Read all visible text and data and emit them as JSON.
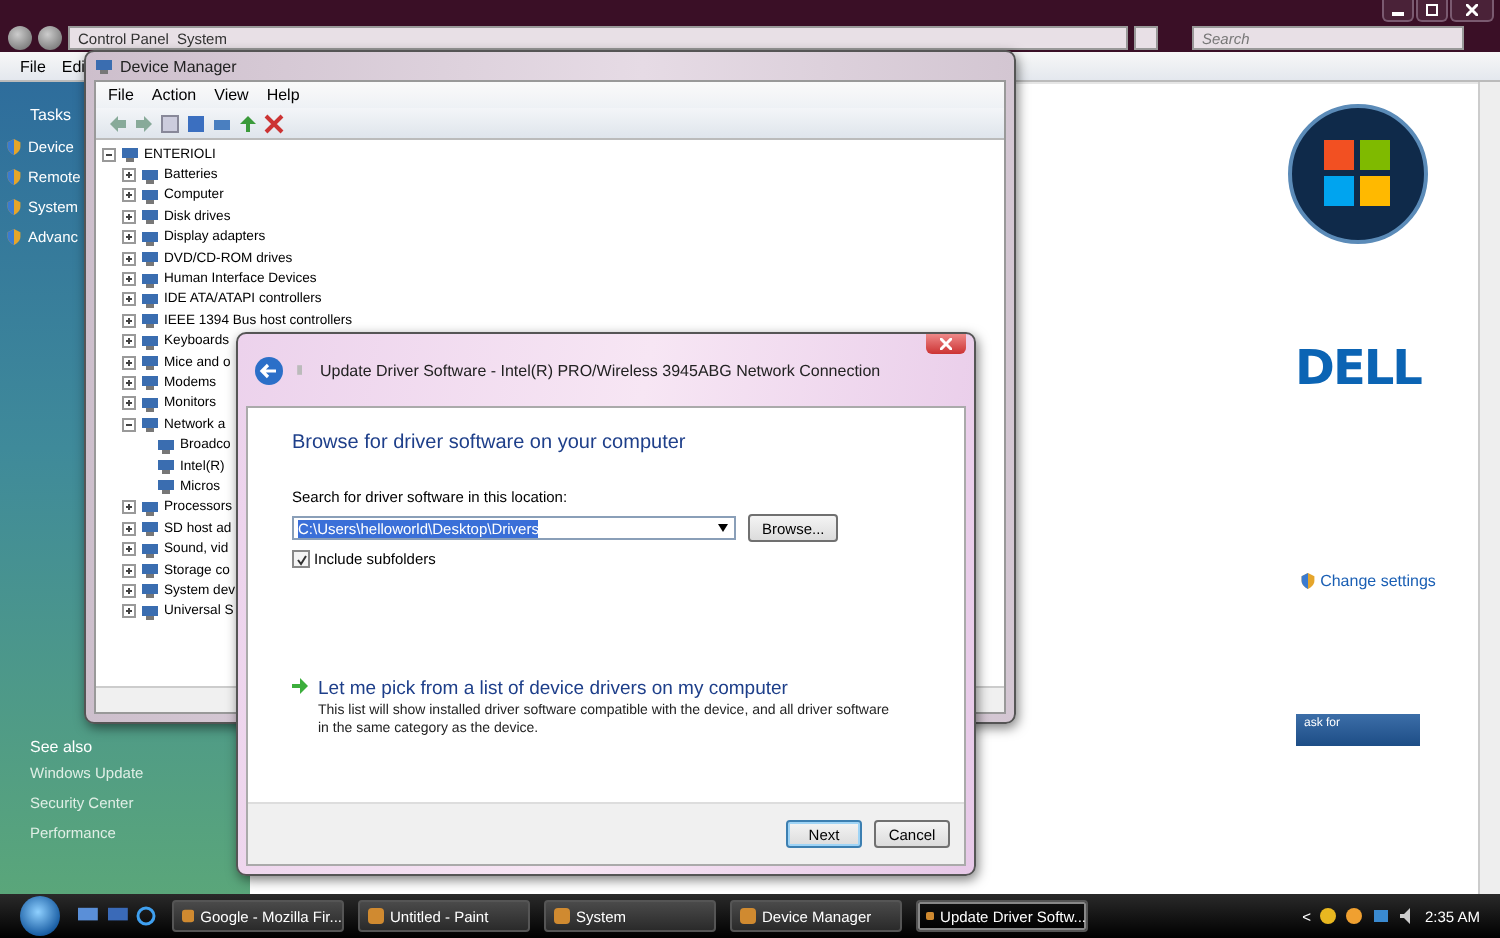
{
  "control_panel": {
    "address": [
      "Control Panel",
      "System"
    ],
    "search": {
      "placeholder": "Search"
    },
    "menu": [
      "File",
      "Edi"
    ],
    "tasks_heading": "Tasks",
    "tasks": [
      "Device",
      "Remote",
      "System",
      "Advanc"
    ],
    "see_also_heading": "See also",
    "see_also": [
      "Windows Update",
      "Security Center",
      "Performance"
    ],
    "oem_logo": "DELL",
    "change_settings": "Change settings",
    "genuine_badge": "ask for"
  },
  "device_manager": {
    "title": "Device Manager",
    "menu": [
      "File",
      "Action",
      "View",
      "Help"
    ],
    "tree": [
      {
        "label": "ENTERIOLI",
        "expanded": true,
        "children": [
          {
            "label": "Batteries",
            "expanded": false
          },
          {
            "label": "Computer",
            "expanded": false
          },
          {
            "label": "Disk drives",
            "expanded": false
          },
          {
            "label": "Display adapters",
            "expanded": false
          },
          {
            "label": "DVD/CD-ROM drives",
            "expanded": false
          },
          {
            "label": "Human Interface Devices",
            "expanded": false
          },
          {
            "label": "IDE ATA/ATAPI controllers",
            "expanded": false
          },
          {
            "label": "IEEE 1394 Bus host controllers",
            "expanded": false
          },
          {
            "label": "Keyboards",
            "expanded": false
          },
          {
            "label": "Mice and o",
            "expanded": false
          },
          {
            "label": "Modems",
            "expanded": false
          },
          {
            "label": "Monitors",
            "expanded": false
          },
          {
            "label": "Network a",
            "expanded": true,
            "children": [
              {
                "label": "Broadco"
              },
              {
                "label": "Intel(R)"
              },
              {
                "label": "Micros"
              }
            ]
          },
          {
            "label": "Processors",
            "expanded": false
          },
          {
            "label": "SD host ad",
            "expanded": false
          },
          {
            "label": "Sound, vid",
            "expanded": false
          },
          {
            "label": "Storage co",
            "expanded": false
          },
          {
            "label": "System dev",
            "expanded": false
          },
          {
            "label": "Universal S",
            "expanded": false
          }
        ]
      }
    ]
  },
  "dialog": {
    "title": "Update Driver Software - Intel(R) PRO/Wireless 3945ABG Network Connection",
    "heading": "Browse for driver software on your computer",
    "location_label": "Search for driver software in this location:",
    "location_value": "C:\\Users\\helloworld\\Desktop\\Drivers",
    "browse_button": "Browse...",
    "include_subfolders": {
      "label": "Include subfolders",
      "checked": true
    },
    "pick_option": {
      "title": "Let me pick from a list of device drivers on my computer",
      "description": "This list will show installed driver software compatible with the device, and all driver software in the same category as the device."
    },
    "buttons": [
      {
        "label": "Next",
        "default": true
      },
      {
        "label": "Cancel",
        "default": false
      }
    ]
  },
  "taskbar": {
    "tasks": [
      {
        "label": "Google - Mozilla Fir...",
        "selected": false
      },
      {
        "label": "Untitled - Paint",
        "selected": false
      },
      {
        "label": "System",
        "selected": false
      },
      {
        "label": "Device Manager",
        "selected": false
      },
      {
        "label": "Update Driver Softw...",
        "selected": true
      }
    ],
    "tray_arrow": "<",
    "clock": "2:35 AM"
  }
}
